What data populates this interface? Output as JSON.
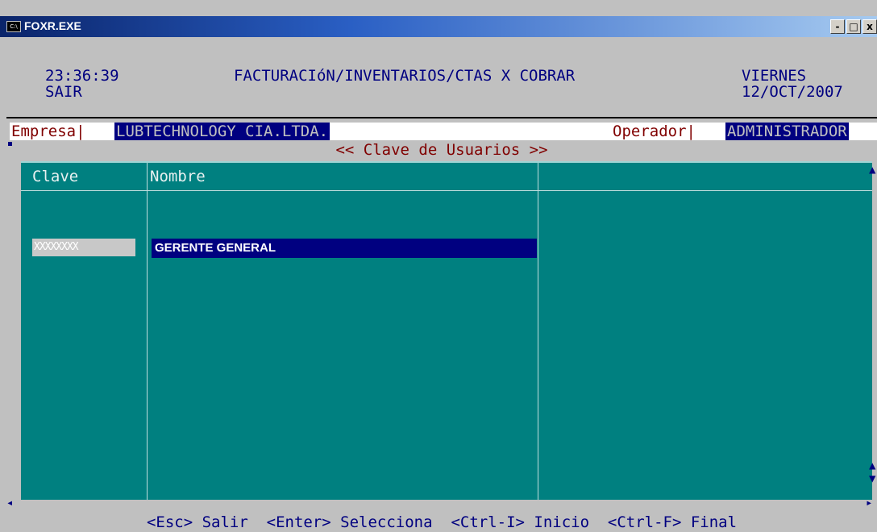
{
  "window": {
    "title": "FOXR.EXE",
    "icon_label": "C:\\",
    "buttons": {
      "minimize": "-",
      "maximize": "□",
      "close": "x"
    }
  },
  "header": {
    "time": "23:36:39",
    "user": "SAIR",
    "system_title": "FACTURACIóN/INVENTARIOS/CTAS X COBRAR",
    "weekday": "VIERNES",
    "date": "12/OCT/2007"
  },
  "info_bar": {
    "company_label": "Empresa|",
    "company_value": "LUBTECHNOLOGY CIA.LTDA.",
    "operator_label": "Operador|",
    "operator_value": "ADMINISTRADOR"
  },
  "table": {
    "title": "<< Clave de Usuarios >>",
    "columns": [
      "Clave",
      "Nombre",
      ""
    ],
    "rows": [
      {
        "clave": "XXXXXXXX",
        "nombre": "GERENTE GENERAL"
      }
    ]
  },
  "footer": {
    "hint": "<Esc> Salir  <Enter> Selecciona  <Ctrl-I> Inicio  <Ctrl-F> Final"
  },
  "colors": {
    "console_bg": "#c0c0c0",
    "grid_bg": "#008080",
    "accent_navy": "#000080",
    "label_red": "#800000"
  },
  "icons": [
    "console-app-icon",
    "minimize-icon",
    "maximize-icon",
    "close-icon",
    "scroll-up-arrow-icon",
    "scroll-down-arrow-icon",
    "scroll-left-arrow-icon",
    "scroll-right-arrow-icon"
  ]
}
